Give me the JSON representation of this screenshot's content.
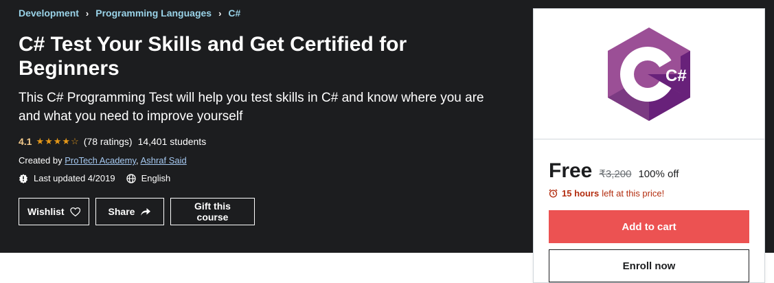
{
  "breadcrumb": [
    {
      "label": "Development"
    },
    {
      "label": "Programming Languages"
    },
    {
      "label": "C#"
    }
  ],
  "course": {
    "title": "C# Test Your Skills and Get Certified for Beginners",
    "subtitle": "This C# Programming Test will help you test skills in C# and know where you are and what you need to improve yourself",
    "rating": "4.1",
    "stars": "★★★★☆",
    "rating_count": "(78 ratings)",
    "students": "14,401 students",
    "created_by_label": "Created by",
    "instructors": [
      "ProTech Academy",
      "Ashraf Said"
    ],
    "last_updated": "Last updated 4/2019",
    "language": "English"
  },
  "buttons": {
    "wishlist": "Wishlist",
    "share": "Share",
    "gift": "Gift this course"
  },
  "sidebar": {
    "price": "Free",
    "original_price": "₹3,200",
    "discount": "100% off",
    "timer_bold": "15 hours",
    "timer_rest": "left at this price!",
    "add_to_cart": "Add to cart",
    "enroll": "Enroll now",
    "logo_text": "C#"
  },
  "colors": {
    "hero_bg": "#1c1d1f",
    "accent_red": "#ec5252",
    "timer_red": "#b32d0f",
    "logo_purple": "#9b4f96",
    "logo_dark_purple": "#68217a"
  }
}
